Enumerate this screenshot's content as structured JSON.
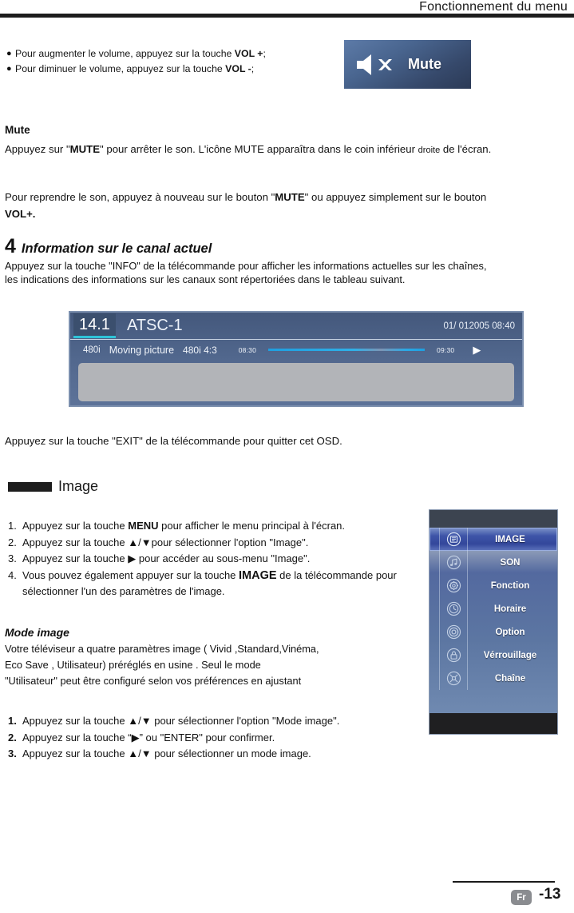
{
  "header": {
    "title": "Fonctionnement du menu"
  },
  "volume_bullets": [
    {
      "bullet": "●",
      "text_before": "Pour augmenter le volume, appuyez sur la touche ",
      "key": "VOL +",
      "text_after": ";"
    },
    {
      "bullet": "●",
      "text_before": "Pour diminuer le volume, appuyez sur la touche ",
      "key": "VOL -",
      "text_after": ";"
    }
  ],
  "mute_graphic": {
    "icon": "speaker-mute-icon",
    "label": "Mute"
  },
  "mute_section": {
    "heading": "Mute",
    "paragraph1_a": "Appuyez sur \"",
    "paragraph1_key": "MUTE",
    "paragraph1_b": "\" pour arrêter le son. L'icône MUTE apparaîtra dans le coin inférieur ",
    "paragraph1_small": "droite",
    "paragraph1_c": " de l'écran.",
    "paragraph2_a": "Pour reprendre le son, appuyez à nouveau sur le bouton \"",
    "paragraph2_key": "MUTE",
    "paragraph2_b": "\" ou appuyez simplement sur le bouton ",
    "paragraph2_key2": "VOL+."
  },
  "section4": {
    "number": "4",
    "title": "Information sur le canal actuel",
    "body": "Appuyez sur la touche \"INFO\" de la télécommande pour afficher les informations actuelles sur les chaînes, les indications des informations sur les canaux sont répertoriées dans le tableau suivant."
  },
  "osd": {
    "channel": "14.1",
    "network": "ATSC-1",
    "datetime": "01/ 012005 08:40",
    "resolution": "480i",
    "program": "Moving picture",
    "format": "480i 4:3",
    "start_time": "08:30",
    "end_time": "09:30",
    "play_icon": "▶"
  },
  "exit_note": "Appuyez sur la touche \"EXIT\" de la télécommande pour quitter cet OSD.",
  "image_section": {
    "label": "Image"
  },
  "steps_image": [
    {
      "num": "1.",
      "a": "Appuyez sur la touche ",
      "key": "MENU",
      "b": " pour afficher le menu principal à l'écran."
    },
    {
      "num": "2.",
      "a": "Appuyez sur la touche ",
      "key": "▲/▼",
      "b": "pour sélectionner l'option \"Image\"."
    },
    {
      "num": "3.",
      "a": "Appuyez sur la touche ",
      "key": "▶",
      "b": "   pour accéder au sous-menu \"Image\"."
    },
    {
      "num": "4.",
      "a": "Vous pouvez également appuyer sur la touche  ",
      "key": "IMAGE",
      "b": "  de la télécommande pour sélectionner l'un des paramètres de l'image."
    }
  ],
  "mode_image": {
    "heading": "Mode  image",
    "line1": "Votre téléviseur a quatre paramètres  image ( Vivid ,Standard,Vinéma,",
    "line2_a": "Eco  Save",
    "line2_b": " , Utilisateur)    préréglés   en   usine  . Seul le mode",
    "line3": "\"Utilisateur\" peut être configuré selon vos préférences en ajustant"
  },
  "steps_mode": [
    {
      "num": "1.",
      "a": "Appuyez sur la touche ",
      "key": "▲/▼",
      "b": "    pour sélectionner l'option \"Mode image\"."
    },
    {
      "num": "2.",
      "a": "Appuyez sur la touche “",
      "key": "▶",
      "b": "” ou \"ENTER\" pour confirmer."
    },
    {
      "num": "3.",
      "a": "Appuyez sur la touche ",
      "key": "▲/▼",
      "b": "    pour sélectionner un mode image."
    }
  ],
  "tv_menu": {
    "items": [
      {
        "label": "IMAGE",
        "icon": "picture-icon",
        "selected": true
      },
      {
        "label": "SON",
        "icon": "music-note-icon",
        "selected": false
      },
      {
        "label": "Fonction",
        "icon": "gear-icon",
        "selected": false
      },
      {
        "label": "Horaire",
        "icon": "clock-icon",
        "selected": false
      },
      {
        "label": "Option",
        "icon": "target-circle-icon",
        "selected": false
      },
      {
        "label": "Vérrouillage",
        "icon": "lock-icon",
        "selected": false
      },
      {
        "label": "Chaîne",
        "icon": "antenna-icon",
        "selected": false
      }
    ],
    "selected_color": "#3a4fa0"
  },
  "footer": {
    "language_badge": "Fr",
    "page": "-13"
  }
}
